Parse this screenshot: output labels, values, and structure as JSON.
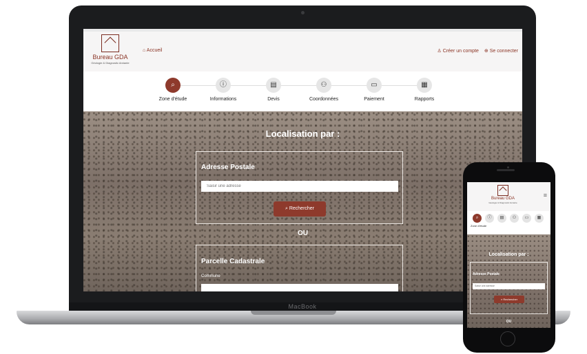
{
  "laptop": {
    "brand": "MacBook"
  },
  "site": {
    "logo_name": "Bureau GDA",
    "logo_tagline": "Géologie & Diagnostic Amiante",
    "nav_home": "Accueil",
    "nav_create_account": "Créer un compte",
    "nav_login": "Se connecter",
    "steps": [
      {
        "label": "Zone d'étude",
        "icon": "search-icon",
        "active": true
      },
      {
        "label": "Informations",
        "icon": "info-icon",
        "active": false
      },
      {
        "label": "Devis",
        "icon": "document-icon",
        "active": false
      },
      {
        "label": "Coordonnées",
        "icon": "contacts-icon",
        "active": false
      },
      {
        "label": "Paiement",
        "icon": "card-icon",
        "active": false
      },
      {
        "label": "Rapports",
        "icon": "report-icon",
        "active": false
      }
    ],
    "hero_title": "Localisation par :",
    "address_section_title": "Adresse Postale",
    "address_placeholder": "Saisir une adresse",
    "search_button": "Rechercher",
    "or_text": "OU",
    "cadastre_title": "Parcelle Cadastrale",
    "commune_label": "Commune"
  },
  "phone": {
    "step_label": "Zone d'étude"
  },
  "colors": {
    "accent": "#8e3a2c",
    "brand_text": "#8a3324"
  }
}
